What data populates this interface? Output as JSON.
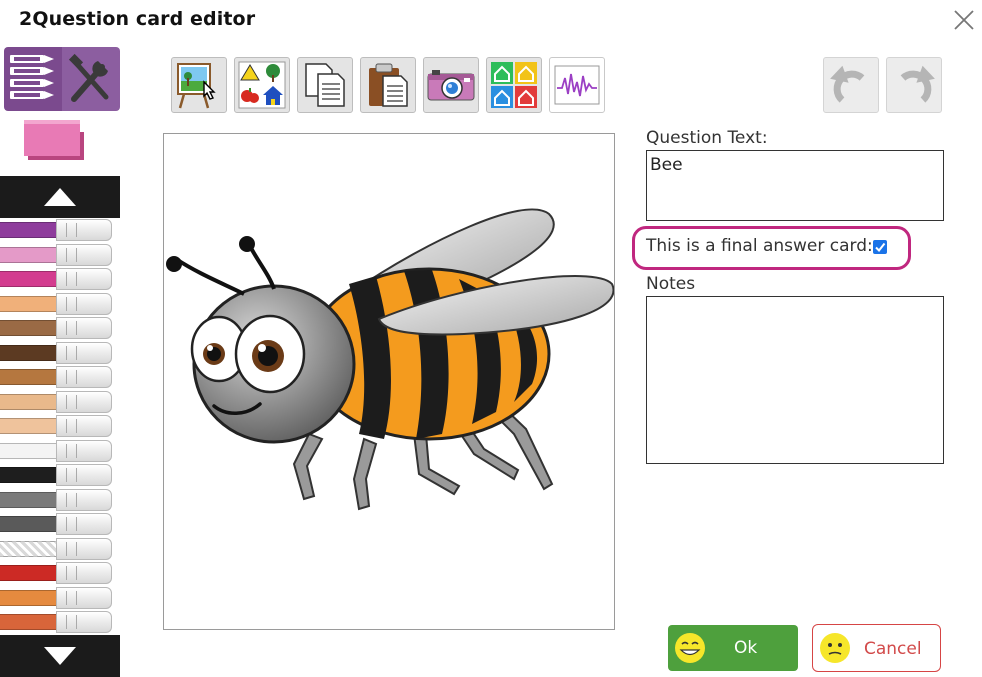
{
  "dialog": {
    "title": "2Question card editor"
  },
  "toolbar": {
    "buttons": [
      {
        "icon": "easel-pointer-icon"
      },
      {
        "icon": "symbols-gallery-icon"
      },
      {
        "icon": "copy-icon"
      },
      {
        "icon": "paste-icon"
      },
      {
        "icon": "camera-icon"
      },
      {
        "icon": "quadrant-houses-icon"
      },
      {
        "icon": "waveform-icon",
        "active": true
      }
    ],
    "undo_icon": "undo-icon",
    "redo_icon": "redo-icon"
  },
  "left_tools": {
    "pen_colors": [
      "#8e3c9c",
      "#e49ac8",
      "#d33c8f",
      "#f0b07a",
      "#9a6a45",
      "#5c3a22",
      "#b5773f",
      "#e9b98b",
      "#efc39c",
      "#f4f4f4",
      "#1e1e1e",
      "#7a7a7a",
      "#5a5a5a",
      "checker",
      "#cc2a25",
      "#e58a3f",
      "#d8653a"
    ]
  },
  "form": {
    "question_label": "Question Text:",
    "question_value": "Bee",
    "final_label": "This is a final answer card:",
    "final_checked": true,
    "notes_label": "Notes",
    "notes_value": ""
  },
  "actions": {
    "ok_label": "Ok",
    "cancel_label": "Cancel"
  },
  "colors": {
    "accent_purple": "#7b4a8e",
    "highlight": "#c0277f",
    "ok_green": "#4ea03d",
    "cancel_red": "#d24a4a"
  }
}
